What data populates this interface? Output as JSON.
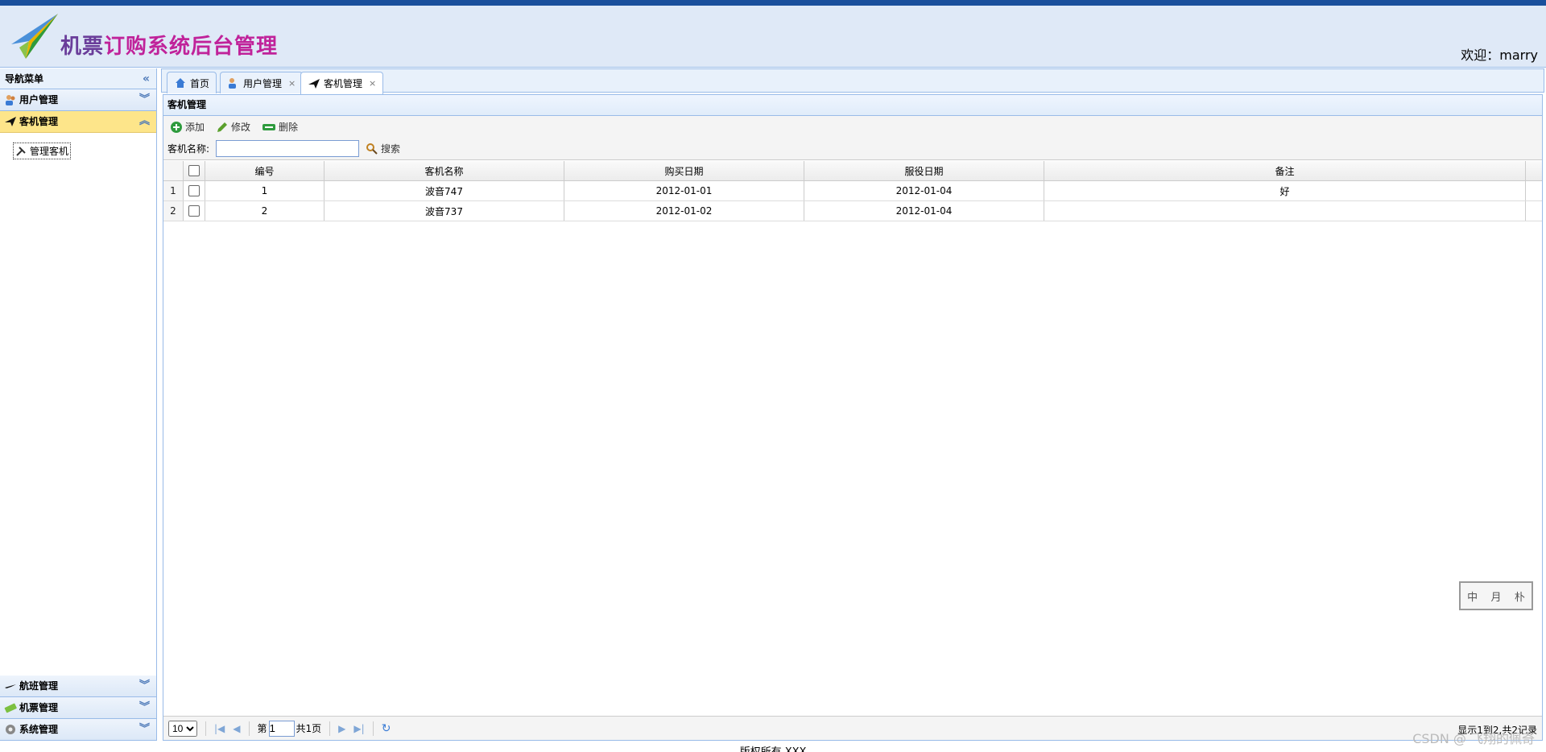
{
  "header": {
    "logo_text_a": "机票",
    "logo_text_b": "订购系统后台管理",
    "welcome": "欢迎：marry"
  },
  "nav": {
    "title": "导航菜单",
    "sections": [
      {
        "label": "用户管理",
        "icon": "users-icon"
      },
      {
        "label": "客机管理",
        "icon": "plane-icon"
      },
      {
        "label": "航班管理",
        "icon": "flight-icon"
      },
      {
        "label": "机票管理",
        "icon": "ticket-icon"
      },
      {
        "label": "系统管理",
        "icon": "gear-icon"
      }
    ],
    "active_sub_item": "管理客机"
  },
  "tabs": [
    {
      "label": "首页",
      "icon": "home-icon",
      "closable": false
    },
    {
      "label": "用户管理",
      "icon": "users-icon",
      "closable": true
    },
    {
      "label": "客机管理",
      "icon": "plane-icon",
      "closable": true
    }
  ],
  "panel": {
    "title": "客机管理",
    "toolbar": {
      "add": "添加",
      "edit": "修改",
      "delete": "删除"
    },
    "search": {
      "label": "客机名称:",
      "value": "",
      "button": "搜索"
    }
  },
  "grid": {
    "columns": [
      "编号",
      "客机名称",
      "购买日期",
      "服役日期",
      "备注"
    ],
    "rows": [
      {
        "rownum": "1",
        "id": "1",
        "name": "波音747",
        "buy_date": "2012-01-01",
        "service_date": "2012-01-04",
        "note": "好"
      },
      {
        "rownum": "2",
        "id": "2",
        "name": "波音737",
        "buy_date": "2012-01-02",
        "service_date": "2012-01-04",
        "note": ""
      }
    ]
  },
  "pager": {
    "page_size": "10",
    "page_prefix": "第",
    "page_value": "1",
    "page_suffix": "共1页",
    "info": "显示1到2,共2记录"
  },
  "stamp": {
    "chars": [
      "中",
      "月",
      "朴"
    ]
  },
  "footer": {
    "text": "版权所有 XXX"
  },
  "watermark": "CSDN @ 飞翔的佩奇",
  "colors": {
    "topbar": "#1a4f9c",
    "header_bg": "#dfe9f7",
    "active_menu": "#fde58a",
    "border": "#99bbe8",
    "logo_pink": "#c0229a"
  }
}
